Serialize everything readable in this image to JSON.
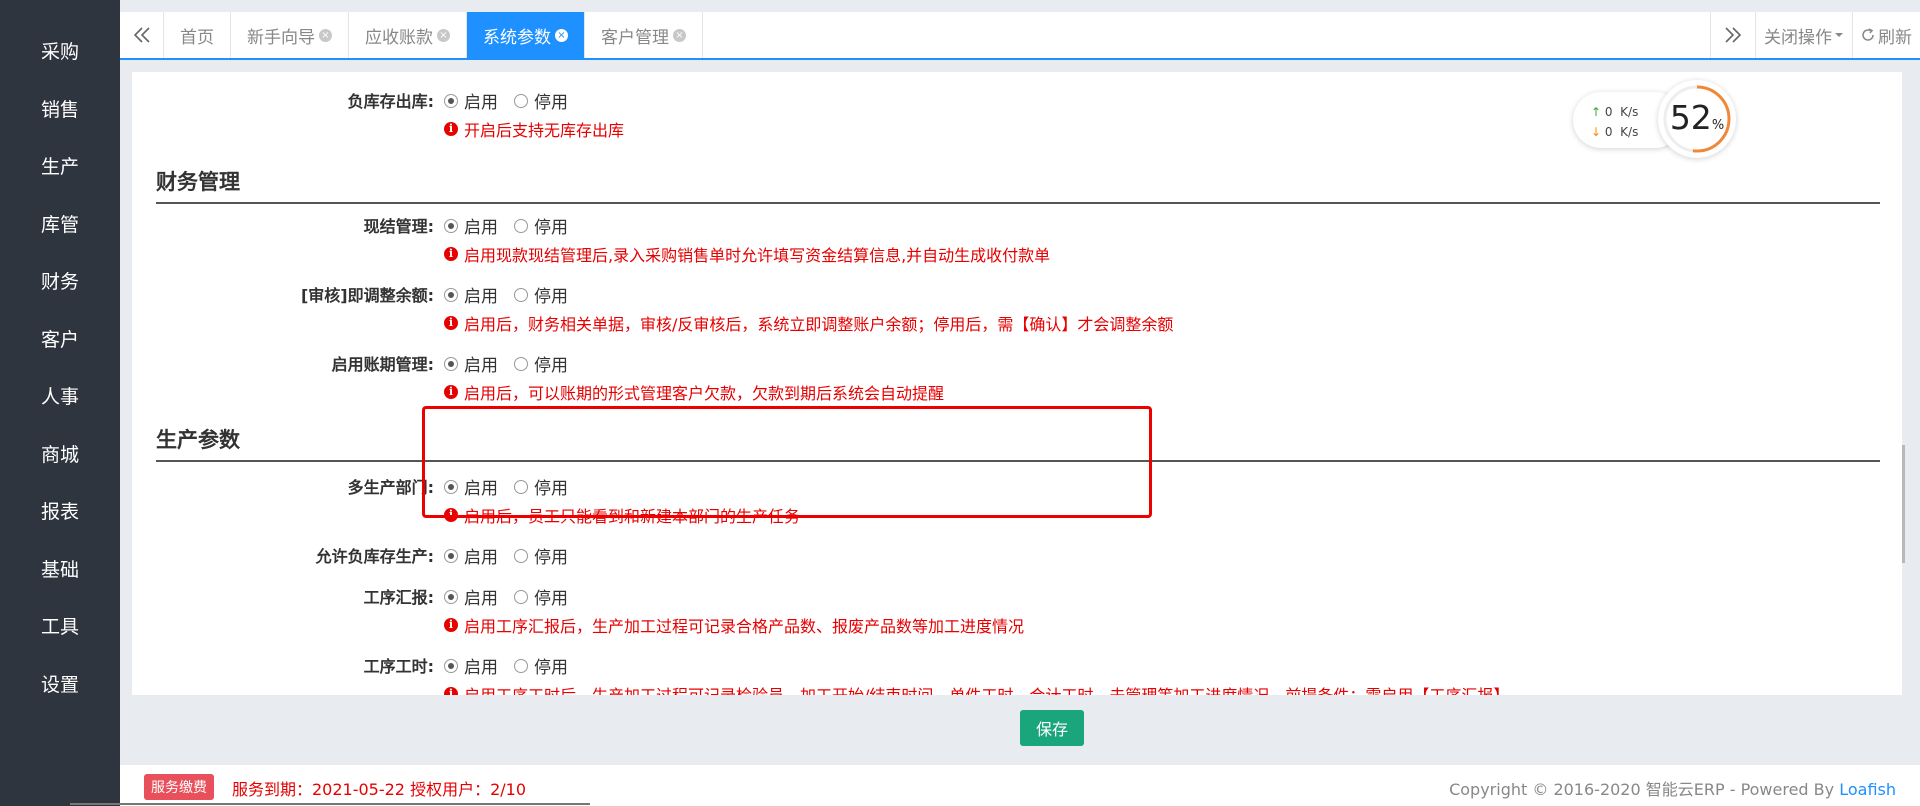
{
  "sidebar": {
    "items": [
      {
        "label": "采购"
      },
      {
        "label": "销售"
      },
      {
        "label": "生产"
      },
      {
        "label": "库管"
      },
      {
        "label": "财务"
      },
      {
        "label": "客户"
      },
      {
        "label": "人事"
      },
      {
        "label": "商城"
      },
      {
        "label": "报表"
      },
      {
        "label": "基础"
      },
      {
        "label": "工具"
      },
      {
        "label": "设置"
      }
    ]
  },
  "tabs": {
    "prev_icon": "double-chevron-left-icon",
    "next_icon": "double-chevron-right-icon",
    "items": [
      {
        "label": "首页",
        "closable": false
      },
      {
        "label": "新手向导",
        "closable": true
      },
      {
        "label": "应收账款",
        "closable": true
      },
      {
        "label": "系统参数",
        "closable": true,
        "active": true
      },
      {
        "label": "客户管理",
        "closable": true
      }
    ],
    "close_glyph": "×",
    "close_ops_label": "关闭操作",
    "refresh_label": "刷新"
  },
  "settings": {
    "enable_label": "启用",
    "disable_label": "停用",
    "tip_glyph": "i",
    "rows": [
      {
        "label": "负库存出库:",
        "tip": "开启后支持无库存出库"
      },
      {
        "label": "现结管理:",
        "tip": "启用现款现结管理后,录入采购销售单时允许填写资金结算信息,并自动生成收付款单"
      },
      {
        "label": "[审核]即调整余额:",
        "tip": "启用后，财务相关单据，审核/反审核后，系统立即调整账户余额；停用后，需【确认】才会调整余额"
      },
      {
        "label": "启用账期管理:",
        "tip": "启用后，可以账期的形式管理客户欠款，欠款到期后系统会自动提醒"
      },
      {
        "label": "多生产部门:",
        "tip": "启用后，员工只能看到和新建本部门的生产任务"
      },
      {
        "label": "允许负库存生产:",
        "tip": ""
      },
      {
        "label": "工序汇报:",
        "tip": "启用工序汇报后，生产加工过程可记录合格产品数、报废产品数等加工进度情况"
      },
      {
        "label": "工序工时:",
        "tip": "启用工序工时后，生产加工过程可记录检验员、加工开始/结束时间、单件工时、合计工时、未管理等加工进度情况，前提条件：需启用【工序汇报】"
      }
    ],
    "sections": {
      "finance": "财务管理",
      "production": "生产参数"
    }
  },
  "network": {
    "up_speed": "0",
    "down_speed": "0",
    "unit": "K/s",
    "up_arrow": "↑",
    "down_arrow": "↓",
    "percent": "52",
    "percent_sign": "%",
    "ring_color": "#f0883a"
  },
  "save_label": "保存",
  "footer": {
    "badge": "服务缴费",
    "service": "服务到期：2021-05-22   授权用户：2/10",
    "copyright": "Copyright © 2016-2020 智能云ERP - Powered By ",
    "powered_link": "Loafish"
  },
  "colors": {
    "accent": "#1e90ff",
    "sidebar_bg": "#2f353e",
    "tip_red": "#e60000",
    "save_green": "#1aa57a"
  }
}
